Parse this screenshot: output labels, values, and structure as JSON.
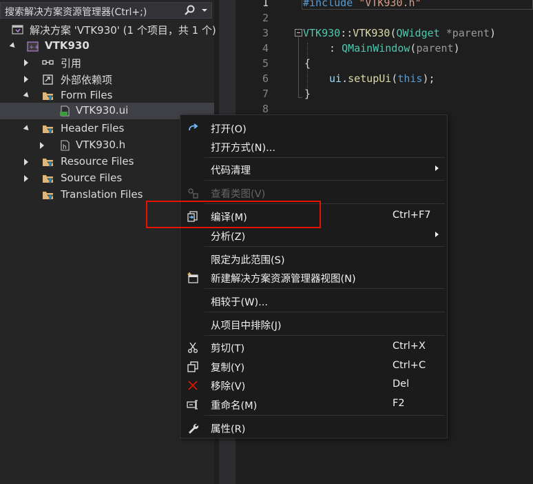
{
  "explorer": {
    "search_placeholder": "搜索解决方案资源管理器(Ctrl+;)",
    "solution_label": "解决方案 'VTK930' (1 个项目，共 1 个)",
    "project_label": "VTK930",
    "items": [
      {
        "label": "引用"
      },
      {
        "label": "外部依赖项"
      },
      {
        "label": "Form Files"
      },
      {
        "label": "VTK930.ui"
      },
      {
        "label": "Header Files"
      },
      {
        "label": "VTK930.h"
      },
      {
        "label": "Resource Files"
      },
      {
        "label": "Source Files"
      },
      {
        "label": "Translation Files"
      }
    ]
  },
  "editor": {
    "line_numbers": [
      "1",
      "2",
      "3",
      "4",
      "5",
      "6",
      "7",
      "8"
    ],
    "line1": {
      "directive": "#include",
      "file": "\"VTK930.h\""
    },
    "line3": {
      "cls": "VTK930",
      "sep": "::",
      "ctor": "VTK930",
      "open": "(",
      "type": "QWidget",
      "ptr": " *parent",
      "close": ")"
    },
    "line4": {
      "colon": ": ",
      "base": "QMainWindow",
      "open": "(",
      "arg": "parent",
      "close": ")"
    },
    "line5": "{",
    "line6": {
      "obj": "ui",
      "dot": ".",
      "call": "setupUi",
      "open": "(",
      "kw": "this",
      "close": ");"
    },
    "line7": "}"
  },
  "context_menu": {
    "items": [
      {
        "label": "打开(O)",
        "icon": "open-arrow-icon"
      },
      {
        "label": "打开方式(N)..."
      },
      {
        "label": "代码清理",
        "submenu": true
      },
      {
        "label": "查看类图(V)",
        "disabled": true,
        "icon": "class-diagram-icon"
      },
      {
        "label": "编译(M)",
        "shortcut": "Ctrl+F7",
        "icon": "compile-icon"
      },
      {
        "label": "分析(Z)",
        "submenu": true
      },
      {
        "label": "限定为此范围(S)"
      },
      {
        "label": "新建解决方案资源管理器视图(N)",
        "icon": "new-view-icon"
      },
      {
        "label": "相较于(W)..."
      },
      {
        "label": "从项目中排除(J)"
      },
      {
        "label": "剪切(T)",
        "shortcut": "Ctrl+X",
        "icon": "scissors-icon"
      },
      {
        "label": "复制(Y)",
        "shortcut": "Ctrl+C",
        "icon": "copy-icon"
      },
      {
        "label": "移除(V)",
        "shortcut": "Del",
        "icon": "remove-x-icon"
      },
      {
        "label": "重命名(M)",
        "shortcut": "F2",
        "icon": "rename-icon"
      },
      {
        "label": "属性(R)",
        "icon": "wrench-icon"
      }
    ]
  },
  "colors": {
    "accent_highlight": "#e51400",
    "vs_purple": "#68217a",
    "folder": "#dcb67a"
  }
}
